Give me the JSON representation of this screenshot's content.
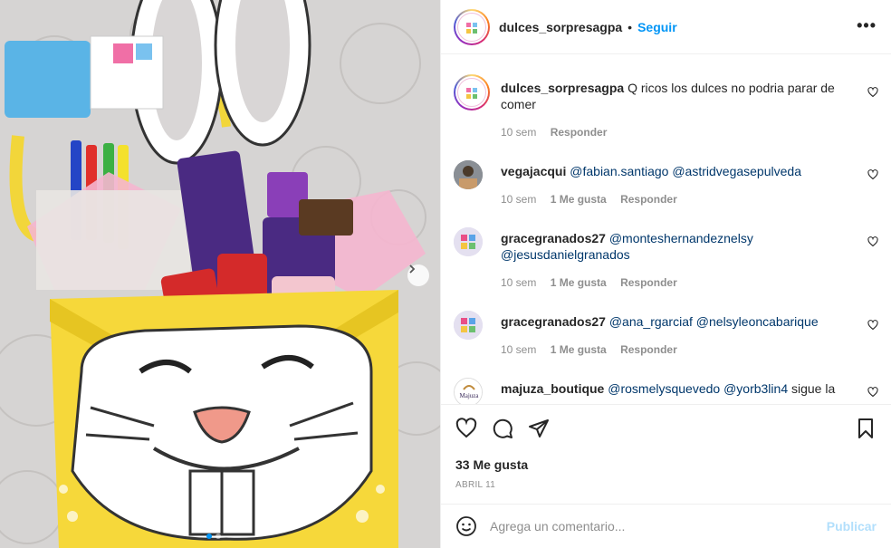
{
  "post": {
    "author": "dulces_sorpresagpa",
    "follow_label": "Seguir",
    "more_label": "•••",
    "separator": "•"
  },
  "comments": [
    {
      "user": "dulces_sorpresagpa",
      "text": "Q ricos los dulces no podria parar de comer",
      "time": "10 sem",
      "likes": "",
      "reply": "Responder"
    },
    {
      "user": "vegajacqui",
      "mentions": [
        "@fabian.santiago",
        "@astridvegasepulveda"
      ],
      "text": "",
      "time": "10 sem",
      "likes": "1 Me gusta",
      "reply": "Responder"
    },
    {
      "user": "gracegranados27",
      "mentions": [
        "@monteshernandeznelsy",
        "@jesusdanielgranados"
      ],
      "text": "",
      "time": "10 sem",
      "likes": "1 Me gusta",
      "reply": "Responder"
    },
    {
      "user": "gracegranados27",
      "mentions": [
        "@ana_rgarciaf",
        "@nelsyleoncabarique"
      ],
      "text": "",
      "time": "10 sem",
      "likes": "1 Me gusta",
      "reply": "Responder"
    },
    {
      "user": "majuza_boutique",
      "mentions": [
        "@rosmelysquevedo",
        "@yorb3lin4"
      ],
      "text": "sigue la",
      "time": "",
      "likes": "",
      "reply": ""
    }
  ],
  "majuza_logo_text": "Majuza",
  "actions": {
    "like_icon": "heart-icon",
    "comment_icon": "comment-icon",
    "share_icon": "share-icon",
    "save_icon": "bookmark-icon"
  },
  "likes_count": "33 Me gusta",
  "date": "ABRIL 11",
  "add_comment": {
    "placeholder": "Agrega un comentario...",
    "publish_label": "Publicar",
    "emoji_icon": "emoji-icon"
  },
  "colors": {
    "accent": "#0095f6",
    "publish_disabled": "#b2dffc",
    "muted": "#8e8e8e",
    "mention": "#00376b"
  },
  "carousel": {
    "slides": 2,
    "current": 1
  }
}
